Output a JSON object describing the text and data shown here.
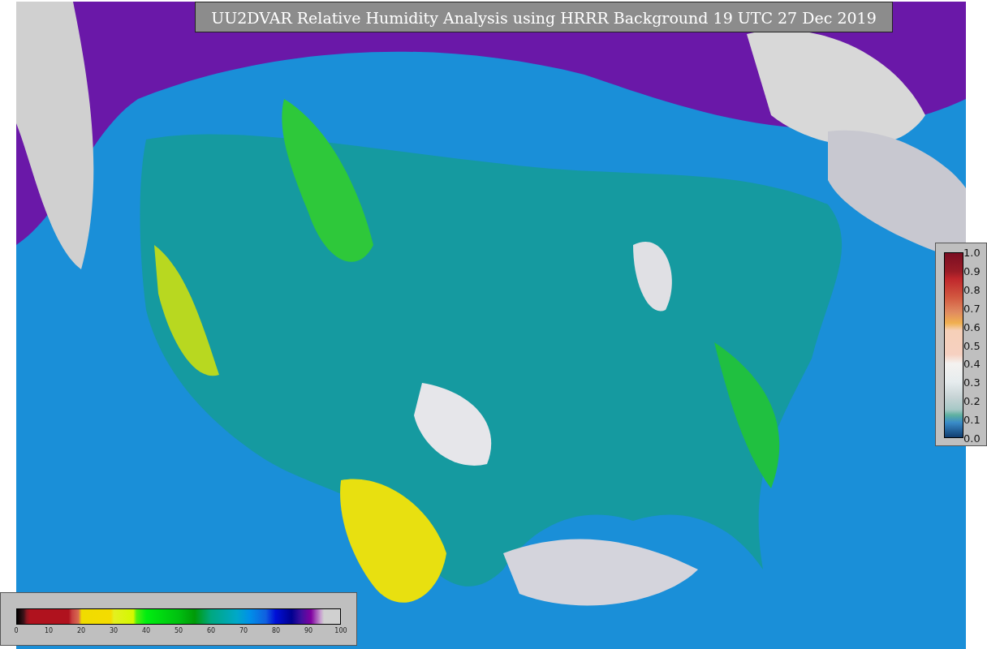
{
  "title": "UU2DVAR Relative Humidity Analysis using HRRR Background 19 UTC 27 Dec 2019",
  "horizontal_colorbar": {
    "ticks": [
      "0",
      "10",
      "20",
      "30",
      "40",
      "50",
      "60",
      "70",
      "80",
      "90",
      "100"
    ]
  },
  "vertical_colorbar": {
    "ticks": [
      "1.0",
      "0.9",
      "0.8",
      "0.7",
      "0.6",
      "0.5",
      "0.4",
      "0.3",
      "0.2",
      "0.1",
      "0.0"
    ]
  }
}
